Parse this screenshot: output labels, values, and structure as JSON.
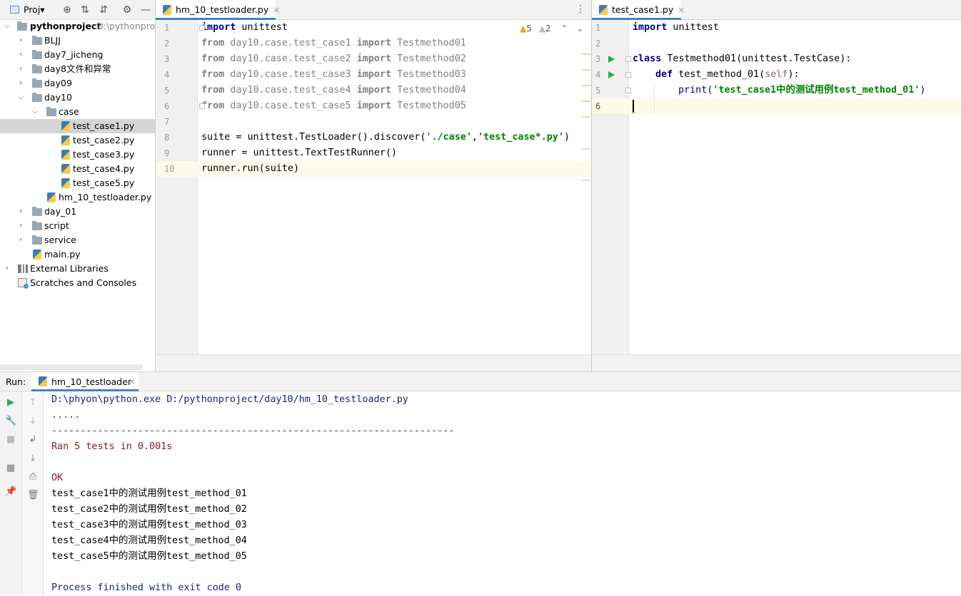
{
  "project": {
    "title": "Proj▾",
    "root_name": "pythonproject",
    "root_path": "D:\\pythonproj",
    "items": [
      {
        "label": "BLJJ"
      },
      {
        "label": "day7_jicheng"
      },
      {
        "label": "day8文件和异常"
      },
      {
        "label": "day09"
      },
      {
        "label": "day10"
      },
      {
        "label": "case"
      },
      {
        "label": "test_case1.py"
      },
      {
        "label": "test_case2.py"
      },
      {
        "label": "test_case3.py"
      },
      {
        "label": "test_case4.py"
      },
      {
        "label": "test_case5.py"
      },
      {
        "label": "hm_10_testloader.py"
      },
      {
        "label": "day_01"
      },
      {
        "label": "script"
      },
      {
        "label": "service"
      },
      {
        "label": "main.py"
      },
      {
        "label": "External Libraries"
      },
      {
        "label": "Scratches and Consoles"
      }
    ]
  },
  "editor_left": {
    "tab_label": "hm_10_testloader.py",
    "warnings": "5",
    "weak_warnings": "2",
    "line_numbers": [
      "1",
      "2",
      "3",
      "4",
      "5",
      "6",
      "7",
      "8",
      "9",
      "10"
    ],
    "lines": [
      {
        "kw1": "import",
        "rest": " unittest"
      },
      {
        "kw1": "from",
        "mod": " day10.case.test_case1 ",
        "kw2": "import",
        "name": " Testmethod01"
      },
      {
        "kw1": "from",
        "mod": " day10.case.test_case2 ",
        "kw2": "import",
        "name": " Testmethod02"
      },
      {
        "kw1": "from",
        "mod": " day10.case.test_case3 ",
        "kw2": "import",
        "name": " Testmethod03"
      },
      {
        "kw1": "from",
        "mod": " day10.case.test_case4 ",
        "kw2": "import",
        "name": " Testmethod04"
      },
      {
        "kw1": "from",
        "mod": " day10.case.test_case5 ",
        "kw2": "import",
        "name": " Testmethod05"
      },
      {
        "text": ""
      },
      {
        "pre": "suite = unittest.TestLoader().discover(",
        "s1": "'./case'",
        "comma": ",",
        "s2": "'test_case*.py'",
        "post": ")"
      },
      {
        "text": "runner = unittest.TextTestRunner()"
      },
      {
        "text": "runner.run(suite)"
      }
    ]
  },
  "editor_right": {
    "tab_label": "test_case1.py",
    "line_numbers": [
      "1",
      "2",
      "3",
      "4",
      "5",
      "6"
    ],
    "line1_kw": "import",
    "line1_rest": " unittest",
    "line3_kw": "class",
    "line3_rest": " Testmethod01(unittest.TestCase):",
    "line4_kw": "def",
    "line4_name": " test_method_01(",
    "line4_self": "self",
    "line4_end": "):",
    "line5_fn": "print(",
    "line5_str": "'test_case1中的测试用例test_method_01'",
    "line5_end": ")"
  },
  "run": {
    "label": "Run:",
    "tab_label": "hm_10_testloader",
    "output": [
      {
        "text": "D:\\phyon\\python.exe D:/pythonproject/day10/hm_10_testloader.py",
        "color": "blue"
      },
      {
        "text": ".....",
        "color": "red"
      },
      {
        "text": "----------------------------------------------------------------------",
        "color": "red"
      },
      {
        "text": "Ran 5 tests in 0.001s",
        "color": "red"
      },
      {
        "text": "",
        "color": "red"
      },
      {
        "text": "OK",
        "color": "red"
      },
      {
        "text": "test_case1中的测试用例test_method_01",
        "color": "black"
      },
      {
        "text": "test_case2中的测试用例test_method_02",
        "color": "black"
      },
      {
        "text": "test_case3中的测试用例test_method_03",
        "color": "black"
      },
      {
        "text": "test_case4中的测试用例test_method_04",
        "color": "black"
      },
      {
        "text": "test_case5中的测试用例test_method_05",
        "color": "black"
      },
      {
        "text": "",
        "color": "black"
      },
      {
        "text": "Process finished with exit code 0",
        "color": "blue"
      }
    ]
  }
}
